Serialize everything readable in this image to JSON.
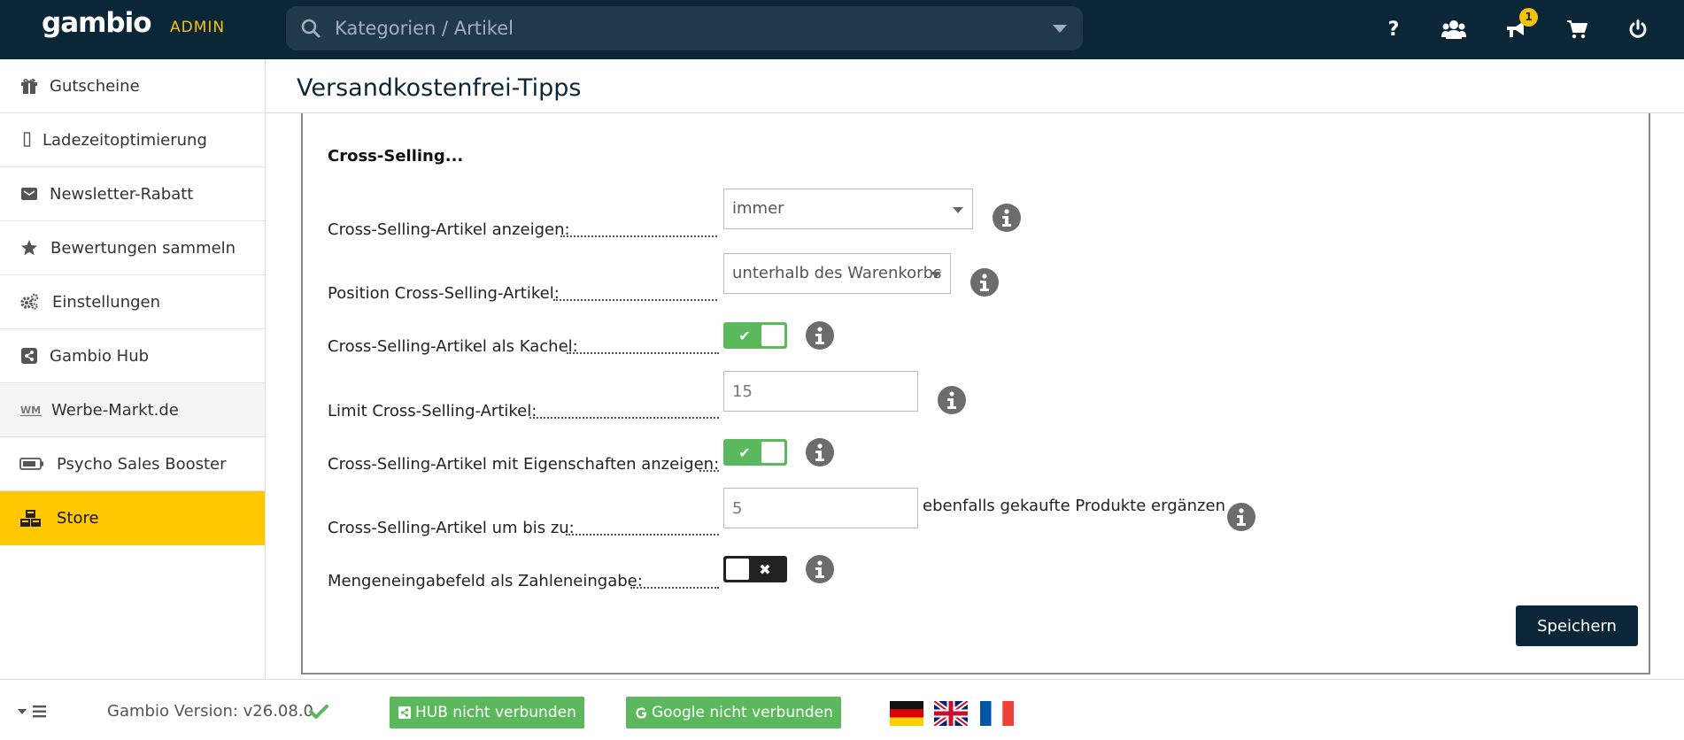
{
  "header": {
    "logo": "gambio",
    "admin_label": "ADMIN",
    "search_placeholder": "Kategorien / Artikel",
    "notification_count": "1",
    "icons": [
      "help-icon",
      "users-icon",
      "megaphone-icon",
      "cart-icon",
      "power-icon"
    ]
  },
  "sidebar": {
    "items": [
      {
        "label": "Gutscheine",
        "icon": "gift-icon"
      },
      {
        "label": "Ladezeitoptimierung",
        "icon": "placeholder-icon"
      },
      {
        "label": "Newsletter-Rabatt",
        "icon": "envelope-icon"
      },
      {
        "label": "Bewertungen sammeln",
        "icon": "star-icon"
      },
      {
        "label": "Einstellungen",
        "icon": "cogs-icon"
      },
      {
        "label": "Gambio Hub",
        "icon": "share-icon"
      },
      {
        "label": "Werbe-Markt.de",
        "icon": "wm-logo-icon"
      },
      {
        "label": "Psycho Sales Booster",
        "icon": "battery-icon"
      },
      {
        "label": "Store",
        "icon": "cubes-icon"
      }
    ]
  },
  "main": {
    "page_title": "Versandkostenfrei-Tipps",
    "section_title": "Cross-Selling...",
    "rows": {
      "show_articles": {
        "label": "Cross-Selling-Artikel anzeigen:",
        "value": "immer"
      },
      "position": {
        "label": "Position Cross-Selling-Artikel:",
        "value": "unterhalb des Warenkorbs"
      },
      "as_tile": {
        "label": "Cross-Selling-Artikel als Kachel:",
        "toggle": "on"
      },
      "limit": {
        "label": "Limit Cross-Selling-Artikel:",
        "value": "15"
      },
      "with_properties": {
        "label": "Cross-Selling-Artikel mit Eigenschaften anzeigen:",
        "toggle": "on"
      },
      "fill_up": {
        "label": "Cross-Selling-Artikel um bis zu:",
        "value": "5",
        "suffix": "ebenfalls gekaufte Produkte ergänzen"
      },
      "quantity_input": {
        "label": "Mengeneingabefeld als Zahleneingabe:",
        "toggle": "off"
      }
    },
    "save_label": "Speichern"
  },
  "footer": {
    "version": "Gambio Version: v26.08.0",
    "hub_status": "HUB nicht verbunden",
    "google_status": "Google nicht verbunden",
    "flags": [
      "german-flag",
      "uk-flag",
      "french-flag"
    ]
  },
  "colors": {
    "topbar": "#0b2637",
    "accent_yellow": "#ffc800",
    "toggle_on": "#5cb85c",
    "save_button": "#0b2637"
  }
}
